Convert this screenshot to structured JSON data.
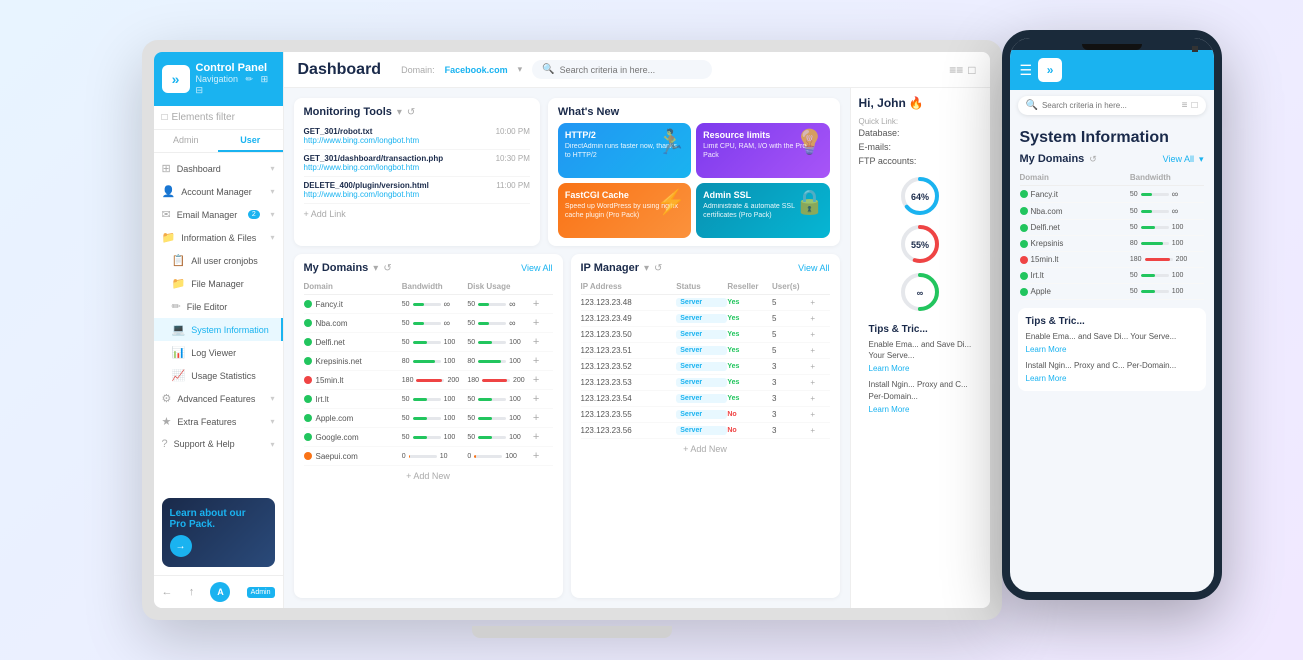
{
  "app": {
    "title": "Control Panel",
    "subtitle": "Navigation",
    "logo": "»"
  },
  "sidebar": {
    "filter_label": "Elements filter",
    "tabs": [
      "Admin",
      "User"
    ],
    "active_tab": "User",
    "nav_items": [
      {
        "icon": "⊞",
        "label": "Dashboard",
        "badge": "",
        "arrow": "▾"
      },
      {
        "icon": "👤",
        "label": "Account Manager",
        "badge": "",
        "arrow": "▾"
      },
      {
        "icon": "✉",
        "label": "Email Manager",
        "badge": "2",
        "arrow": "▾"
      },
      {
        "icon": "📁",
        "label": "Information & Files",
        "badge": "",
        "arrow": "▾"
      },
      {
        "icon": "📋",
        "label": "All user cronjobs",
        "badge": "",
        "arrow": ""
      },
      {
        "icon": "📁",
        "label": "File Manager",
        "badge": "",
        "arrow": ""
      },
      {
        "icon": "✏",
        "label": "File Editor",
        "badge": "",
        "arrow": ""
      },
      {
        "icon": "💻",
        "label": "System Information",
        "badge": "",
        "arrow": "",
        "active": true
      },
      {
        "icon": "📊",
        "label": "Log Viewer",
        "badge": "",
        "arrow": ""
      },
      {
        "icon": "📈",
        "label": "Usage Statistics",
        "badge": "",
        "arrow": ""
      },
      {
        "icon": "⚙",
        "label": "Advanced Features",
        "badge": "",
        "arrow": "▾"
      },
      {
        "icon": "★",
        "label": "Extra Features",
        "badge": "",
        "arrow": "▾"
      },
      {
        "icon": "?",
        "label": "Support & Help",
        "badge": "",
        "arrow": "▾"
      }
    ],
    "promo": {
      "text": "Learn about our",
      "highlight": "Pro Pack."
    },
    "bottom_icons": [
      "←",
      "↑"
    ],
    "admin_badge": "Admin"
  },
  "topbar": {
    "page_title": "Dashboard",
    "domain_label": "Domain:",
    "domain_value": "Facebook.com",
    "search_placeholder": "Search criteria in here...",
    "icons": [
      "≡≡",
      "□"
    ]
  },
  "monitoring": {
    "section_title": "Monitoring Tools",
    "refresh_icon": "↺",
    "dropdown_icon": "▾",
    "items": [
      {
        "method": "GET_301/robot.txt",
        "url": "http://www.bing.com/longbot.htm",
        "time": "10:00 PM"
      },
      {
        "method": "GET_301/dashboard/transaction.php",
        "url": "http://www.bing.com/longbot.htm",
        "time": "10:30 PM"
      },
      {
        "method": "DELETE_400/plugin/version.html",
        "url": "http://www.bing.com/longbot.htm",
        "time": "11:00 PM"
      }
    ],
    "add_label": "+ Add Link"
  },
  "whats_new": {
    "section_title": "What's New",
    "cards": [
      {
        "title": "HTTP/2",
        "text": "DirectAdmin runs faster now, thanks to HTTP/2",
        "color": "blue"
      },
      {
        "title": "Resource limits",
        "text": "Limit CPU, RAM, I/O with the Pro Pack",
        "color": "purple"
      },
      {
        "title": "FastCGI Cache",
        "text": "Speed up WordPress by using nginx cache plugin (Pro Pack)",
        "color": "orange"
      },
      {
        "title": "Admin SSL",
        "text": "Administrate & automate SSL certificates (Pro Pack)",
        "color": "teal"
      }
    ]
  },
  "my_domains": {
    "section_title": "My Domains",
    "view_all": "View All",
    "refresh_icon": "↺",
    "columns": [
      "Domain",
      "Bandwidth",
      "Disk Usage",
      ""
    ],
    "rows": [
      {
        "name": "Fancy.it",
        "status": "green",
        "bw": 50,
        "bw_max": "∞",
        "disk": 50,
        "disk_max": "∞"
      },
      {
        "name": "Nba.com",
        "status": "green",
        "bw": 50,
        "bw_max": "∞",
        "disk": 50,
        "disk_max": "∞"
      },
      {
        "name": "Delfi.net",
        "status": "green",
        "bw": 50,
        "bw_max": 100,
        "disk": 50,
        "disk_max": 100
      },
      {
        "name": "Krepsinis.net",
        "status": "green",
        "bw": 80,
        "bw_max": 100,
        "disk": 80,
        "disk_max": 100
      },
      {
        "name": "15min.lt",
        "status": "red",
        "bw": 180,
        "bw_max": 200,
        "disk": 180,
        "disk_max": 200
      },
      {
        "name": "Irt.lt",
        "status": "green",
        "bw": 50,
        "bw_max": 100,
        "disk": 50,
        "disk_max": 100
      },
      {
        "name": "Apple.com",
        "status": "green",
        "bw": 50,
        "bw_max": 100,
        "disk": 50,
        "disk_max": 100
      },
      {
        "name": "Google.com",
        "status": "green",
        "bw": 50,
        "bw_max": 100,
        "disk": 50,
        "disk_max": 100
      },
      {
        "name": "Saepui.com",
        "status": "orange",
        "bw": 0,
        "bw_max": 10,
        "disk": 0,
        "disk_max": 100
      }
    ],
    "add_label": "+ Add New"
  },
  "ip_manager": {
    "section_title": "IP Manager",
    "view_all": "View All",
    "refresh_icon": "↺",
    "columns": [
      "IP Address",
      "Status",
      "Reseller",
      "User(s)",
      ""
    ],
    "rows": [
      {
        "ip": "123.123.23.48",
        "status": "Server",
        "reseller": "Yes",
        "users": 5
      },
      {
        "ip": "123.123.23.49",
        "status": "Server",
        "reseller": "Yes",
        "users": 5
      },
      {
        "ip": "123.123.23.50",
        "status": "Server",
        "reseller": "Yes",
        "users": 5
      },
      {
        "ip": "123.123.23.51",
        "status": "Server",
        "reseller": "Yes",
        "users": 5
      },
      {
        "ip": "123.123.23.52",
        "status": "Server",
        "reseller": "Yes",
        "users": 3
      },
      {
        "ip": "123.123.23.53",
        "status": "Server",
        "reseller": "Yes",
        "users": 3
      },
      {
        "ip": "123.123.23.54",
        "status": "Server",
        "reseller": "Yes",
        "users": 3
      },
      {
        "ip": "123.123.23.55",
        "status": "Server",
        "reseller": "No",
        "users": 3
      },
      {
        "ip": "123.123.23.56",
        "status": "Server",
        "reseller": "No",
        "users": 3
      }
    ],
    "add_label": "+ Add New"
  },
  "right_panel": {
    "greeting": "Hi, John",
    "emoji": "🔥",
    "quick_link_label": "Quick Link:",
    "links": [
      "Database:",
      "E-mails:",
      "FTP accounts:"
    ],
    "progress_64": 64,
    "progress_55": 55
  },
  "mobile": {
    "title": "System Information",
    "search_placeholder": "Search criteria in here...",
    "domains_title": "My Domains",
    "view_all": "View All",
    "columns": [
      "Domain",
      "Bandwidth"
    ],
    "rows": [
      {
        "name": "Fancy.it",
        "bw": 50,
        "bw_max": "∞",
        "status": "green"
      },
      {
        "name": "Nba.com",
        "bw": 50,
        "bw_max": "∞",
        "status": "green"
      },
      {
        "name": "Delfi.net",
        "bw": 50,
        "bw_max": 100,
        "status": "green"
      },
      {
        "name": "Krepsinis",
        "bw": 80,
        "bw_max": 100,
        "status": "green"
      },
      {
        "name": "15min.lt",
        "bw": 180,
        "bw_max": 200,
        "status": "red"
      },
      {
        "name": "Irt.lt",
        "bw": 50,
        "bw_max": 100,
        "status": "green"
      },
      {
        "name": "Apple",
        "bw": 50,
        "bw_max": 100,
        "status": "green"
      }
    ],
    "tips_title": "Tips & Tric...",
    "tips_text1": "Enable Ema... and Save Di... Your Serve...",
    "learn_more1": "Learn More",
    "tips_text2": "Install Ngin... Proxy and C... Per-Domain...",
    "learn_more2": "Learn More"
  }
}
